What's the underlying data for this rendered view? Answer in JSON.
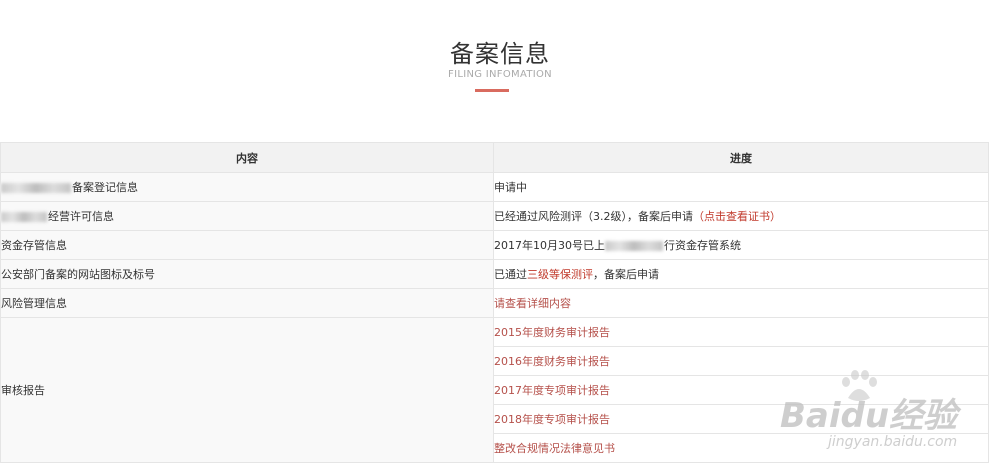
{
  "header": {
    "title_cn": "备案信息",
    "title_en": "FILING INFOMATION"
  },
  "table": {
    "col_content": "内容",
    "col_progress": "进度",
    "rows": [
      {
        "content": "备案登记信息",
        "progress": "申请中"
      },
      {
        "content": "经营许可信息",
        "progress_prefix": "已经通过风险测评（3.2级），备案后申请",
        "progress_link": "（点击查看证书）"
      },
      {
        "content": "资金存管信息",
        "progress_prefix": "2017年10月30号已上",
        "progress_suffix": "行资金存管系统"
      },
      {
        "content": "公安部门备案的网站图标及标号",
        "progress_prefix": "已通过",
        "progress_link": "三级等保测评",
        "progress_suffix": "，备案后申请"
      },
      {
        "content": "风险管理信息",
        "progress_link": "请查看详细内容"
      }
    ],
    "audit": {
      "label": "审核报告",
      "reports": [
        "2015年度财务审计报告",
        "2016年度财务审计报告",
        "2017年度专项审计报告",
        "2018年度专项审计报告",
        "整改合规情况法律意见书"
      ]
    }
  },
  "watermark": {
    "brand": "Baidu经验",
    "url": "jingyan.baidu.com"
  }
}
